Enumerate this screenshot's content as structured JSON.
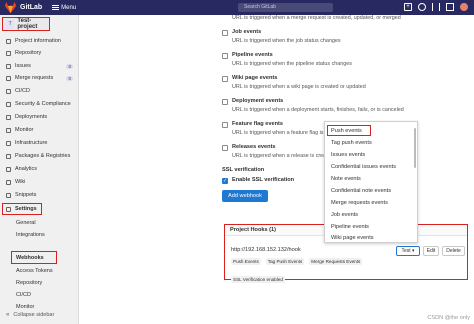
{
  "topnav": {
    "brand": "GitLab",
    "menu_label": "Menu",
    "search_placeholder": "Search GitLab",
    "plus_label": "+"
  },
  "sidebar": {
    "project_avatar": "T",
    "project_name": "Test-project",
    "items": [
      {
        "label": "Project information",
        "icon": "info-icon"
      },
      {
        "label": "Repository",
        "icon": "repository-icon"
      },
      {
        "label": "Issues",
        "icon": "issues-icon",
        "count": "0"
      },
      {
        "label": "Merge requests",
        "icon": "merge-request-icon",
        "count": "0"
      },
      {
        "label": "CI/CD",
        "icon": "rocket-icon"
      },
      {
        "label": "Security & Compliance",
        "icon": "shield-icon"
      },
      {
        "label": "Deployments",
        "icon": "deployments-icon"
      },
      {
        "label": "Monitor",
        "icon": "monitor-icon"
      },
      {
        "label": "Infrastructure",
        "icon": "cloud-icon"
      },
      {
        "label": "Packages & Registries",
        "icon": "package-icon"
      },
      {
        "label": "Analytics",
        "icon": "chart-icon"
      },
      {
        "label": "Wiki",
        "icon": "book-icon"
      },
      {
        "label": "Snippets",
        "icon": "snippet-icon"
      },
      {
        "label": "Settings",
        "icon": "gear-icon"
      }
    ],
    "sub_items": [
      "General",
      "Integrations",
      "Webhooks",
      "Access Tokens",
      "Repository",
      "CI/CD",
      "Monitor"
    ],
    "collapse_label": "Collapse sidebar"
  },
  "events": [
    {
      "title": "",
      "desc": "URL is triggered when a merge request is created, updated, or merged"
    },
    {
      "title": "Job events",
      "desc": "URL is triggered when the job status changes"
    },
    {
      "title": "Pipeline events",
      "desc": "URL is triggered when the pipeline status changes"
    },
    {
      "title": "Wiki page events",
      "desc": "URL is triggered when a wiki page is created or updated"
    },
    {
      "title": "Deployment events",
      "desc": "URL is triggered when a deployment starts, finishes, fails, or is canceled"
    },
    {
      "title": "Feature flag events",
      "desc": "URL is triggered when a feature flag is"
    },
    {
      "title": "Releases events",
      "desc": "URL is triggered when a release is creat"
    }
  ],
  "ssl": {
    "heading": "SSL verification",
    "checkbox_label": "Enable SSL verification"
  },
  "add_button": "Add webhook",
  "project_hooks": {
    "heading": "Project Hooks (1)",
    "url": "http://192.168.152.132/hook",
    "badges": [
      "Push Events",
      "Tag Push Events",
      "Merge Requests Events"
    ],
    "ssl_badge": "SSL Verification enabled",
    "test_label": "Test",
    "edit_label": "Edit",
    "delete_label": "Delete"
  },
  "test_dropdown": [
    "Push events",
    "Tag push events",
    "Issues events",
    "Confidential issues events",
    "Note events",
    "Confidential note events",
    "Merge requests events",
    "Job events",
    "Pipeline events",
    "Wiki page events"
  ],
  "watermark": "CSDN @the  only",
  "colors": {
    "topnav": "#292961",
    "primary": "#1f78d1",
    "highlight": "#dd1f1f"
  }
}
